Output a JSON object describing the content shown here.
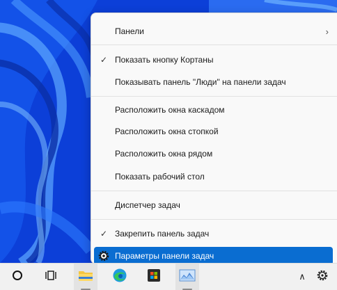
{
  "context_menu": {
    "items": [
      {
        "label": "Панели",
        "has_submenu": true,
        "checked": false
      },
      {
        "label": "Показать кнопку Кортаны",
        "checked": true
      },
      {
        "label": "Показывать панель \"Люди\" на панели задач",
        "checked": false
      },
      {
        "label": "Расположить окна каскадом",
        "checked": false
      },
      {
        "label": "Расположить окна стопкой",
        "checked": false
      },
      {
        "label": "Расположить окна рядом",
        "checked": false
      },
      {
        "label": "Показать рабочий стол",
        "checked": false
      },
      {
        "label": "Диспетчер задач",
        "checked": false
      },
      {
        "label": "Закрепить панель задач",
        "checked": true
      },
      {
        "label": "Параметры панели задач",
        "checked": false,
        "highlighted": true
      }
    ],
    "check_glyph": "✓",
    "submenu_glyph": "›"
  },
  "taskbar": {
    "icons": [
      "cortana-circle-icon",
      "task-view-icon",
      "file-explorer-icon",
      "edge-icon",
      "microsoft-store-icon",
      "photos-icon"
    ],
    "tray": [
      "chevron-up-icon",
      "settings-gear-icon"
    ],
    "tray_chevron_glyph": "∧"
  },
  "colors": {
    "accent": "#0a6dd1",
    "wallpaper": "#0c44e0",
    "menu_bg": "#f9f9f9",
    "taskbar_bg": "#f1f1f1"
  }
}
